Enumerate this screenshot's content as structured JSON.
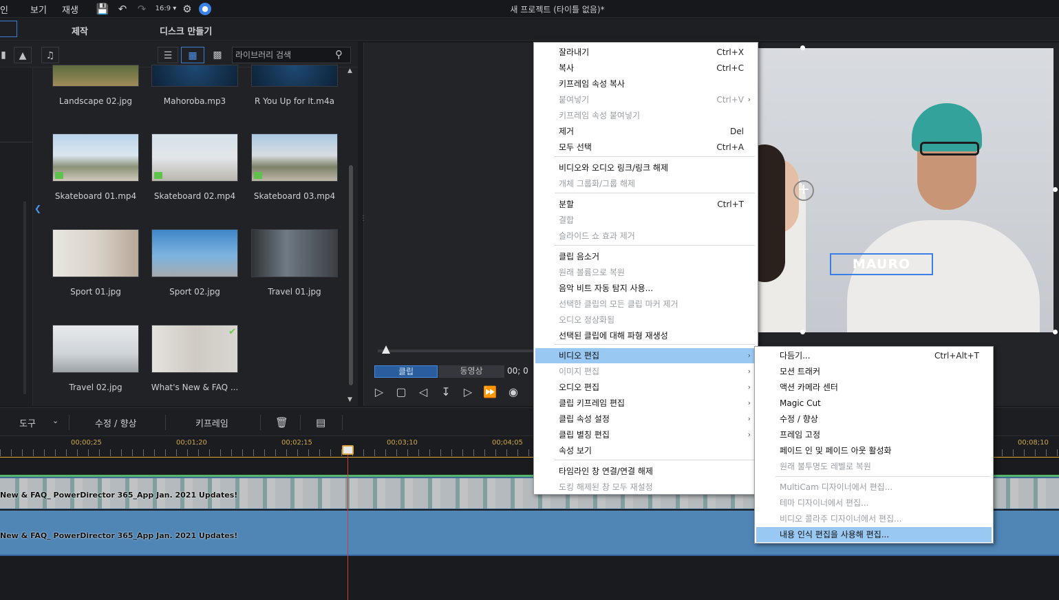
{
  "menubar": {
    "items": [
      "인",
      "보기",
      "재생"
    ],
    "aspect": "16:9",
    "window_title": "새 프로젝트 (타이틀 없음)*"
  },
  "tabs": {
    "edit": "제작",
    "disc": "디스크 만들기"
  },
  "library": {
    "search_placeholder": "라이브러리 검색",
    "items": [
      {
        "label": "Landscape 02.jpg",
        "kind": "image"
      },
      {
        "label": "Mahoroba.mp3",
        "kind": "audio"
      },
      {
        "label": "R You Up for It.m4a",
        "kind": "audio"
      },
      {
        "label": "Skateboard 01.mp4",
        "kind": "video"
      },
      {
        "label": "Skateboard 02.mp4",
        "kind": "video"
      },
      {
        "label": "Skateboard 03.mp4",
        "kind": "video"
      },
      {
        "label": "Sport 01.jpg",
        "kind": "image"
      },
      {
        "label": "Sport 02.jpg",
        "kind": "image"
      },
      {
        "label": "Travel 01.jpg",
        "kind": "image"
      },
      {
        "label": "Travel 02.jpg",
        "kind": "image"
      },
      {
        "label": "What's New & FAQ ...",
        "kind": "video"
      }
    ]
  },
  "preview": {
    "title_text": "MAURO",
    "tab_clip": "클립",
    "tab_movie": "동영상",
    "timecode": "00; 0"
  },
  "timeline_toolbar": {
    "tools": "도구",
    "fix": "수정 / 향상",
    "keyframe": "키프레임"
  },
  "ruler": {
    "ticks": [
      "00;00;25",
      "00;01;20",
      "00;02;15",
      "00;03;10",
      "00;04;05",
      "00;08;10"
    ]
  },
  "tracks": {
    "video_clip": "New & FAQ_ PowerDirector 365_App Jan. 2021 Updates!",
    "audio_clip": "New & FAQ_ PowerDirector 365_App Jan. 2021 Updates!"
  },
  "context_menu": {
    "items": [
      {
        "label": "잘라내기",
        "shortcut": "Ctrl+X",
        "disabled": false
      },
      {
        "label": "복사",
        "shortcut": "Ctrl+C",
        "disabled": false
      },
      {
        "label": "키프레임 속성 복사",
        "shortcut": "",
        "disabled": false
      },
      {
        "label": "붙여넣기",
        "shortcut": "Ctrl+V",
        "disabled": true
      },
      {
        "label": "키프레임 속성 붙여넣기",
        "shortcut": "",
        "disabled": true
      },
      {
        "label": "제거",
        "shortcut": "Del",
        "disabled": false
      },
      {
        "label": "모두 선택",
        "shortcut": "Ctrl+A",
        "disabled": false
      },
      {
        "label": "비디오와 오디오 링크/링크 해제",
        "shortcut": "",
        "disabled": false
      },
      {
        "label": "개체 그룹화/그룹 해제",
        "shortcut": "",
        "disabled": true
      },
      {
        "label": "분할",
        "shortcut": "Ctrl+T",
        "disabled": false
      },
      {
        "label": "결합",
        "shortcut": "",
        "disabled": true
      },
      {
        "label": "슬라이드 쇼 효과 제거",
        "shortcut": "",
        "disabled": true
      },
      {
        "label": "클립 음소거",
        "shortcut": "",
        "disabled": false
      },
      {
        "label": "원래 볼륨으로 복원",
        "shortcut": "",
        "disabled": true
      },
      {
        "label": "음악 비트 자동 탐지 사용...",
        "shortcut": "",
        "disabled": false
      },
      {
        "label": "선택한 클립의 모든 클립 마커 제거",
        "shortcut": "",
        "disabled": true
      },
      {
        "label": "오디오 정상화됨",
        "shortcut": "",
        "disabled": true
      },
      {
        "label": "선택된 클립에 대해 파형 재생성",
        "shortcut": "",
        "disabled": false
      },
      {
        "label": "비디오 편집",
        "shortcut": "",
        "disabled": false,
        "highlight": true
      },
      {
        "label": "이미지 편집",
        "shortcut": "",
        "disabled": true
      },
      {
        "label": "오디오 편집",
        "shortcut": "",
        "disabled": false
      },
      {
        "label": "클립 키프레임 편집",
        "shortcut": "",
        "disabled": false
      },
      {
        "label": "클립 속성 설정",
        "shortcut": "",
        "disabled": false
      },
      {
        "label": "클립 별칭 편집",
        "shortcut": "",
        "disabled": false
      },
      {
        "label": "속성 보기",
        "shortcut": "",
        "disabled": false
      },
      {
        "label": "타임라인 창 연결/연결 해제",
        "shortcut": "",
        "disabled": false
      },
      {
        "label": "도킹 해제된 창 모두 재설정",
        "shortcut": "",
        "disabled": true
      }
    ]
  },
  "submenu": {
    "items": [
      {
        "label": "다듬기...",
        "shortcut": "Ctrl+Alt+T",
        "disabled": false
      },
      {
        "label": "모션 트래커",
        "shortcut": "",
        "disabled": false
      },
      {
        "label": "액션 카메라 센터",
        "shortcut": "",
        "disabled": false
      },
      {
        "label": "Magic Cut",
        "shortcut": "",
        "disabled": false
      },
      {
        "label": "수정 / 향상",
        "shortcut": "",
        "disabled": false
      },
      {
        "label": "프레임 고정",
        "shortcut": "",
        "disabled": false
      },
      {
        "label": "페이드 인 및 페이드 아웃 활성화",
        "shortcut": "",
        "disabled": false
      },
      {
        "label": "원래 불투명도 레벨로 복원",
        "shortcut": "",
        "disabled": true
      },
      {
        "label": "MultiCam 디자이너에서 편집...",
        "shortcut": "",
        "disabled": true
      },
      {
        "label": "테마 디자이너에서 편집...",
        "shortcut": "",
        "disabled": true
      },
      {
        "label": "비디오 콜라주 디자이너에서 편집...",
        "shortcut": "",
        "disabled": true
      },
      {
        "label": "내용 인식 편집을 사용해 편집...",
        "shortcut": "",
        "disabled": false,
        "highlight": true
      }
    ]
  }
}
